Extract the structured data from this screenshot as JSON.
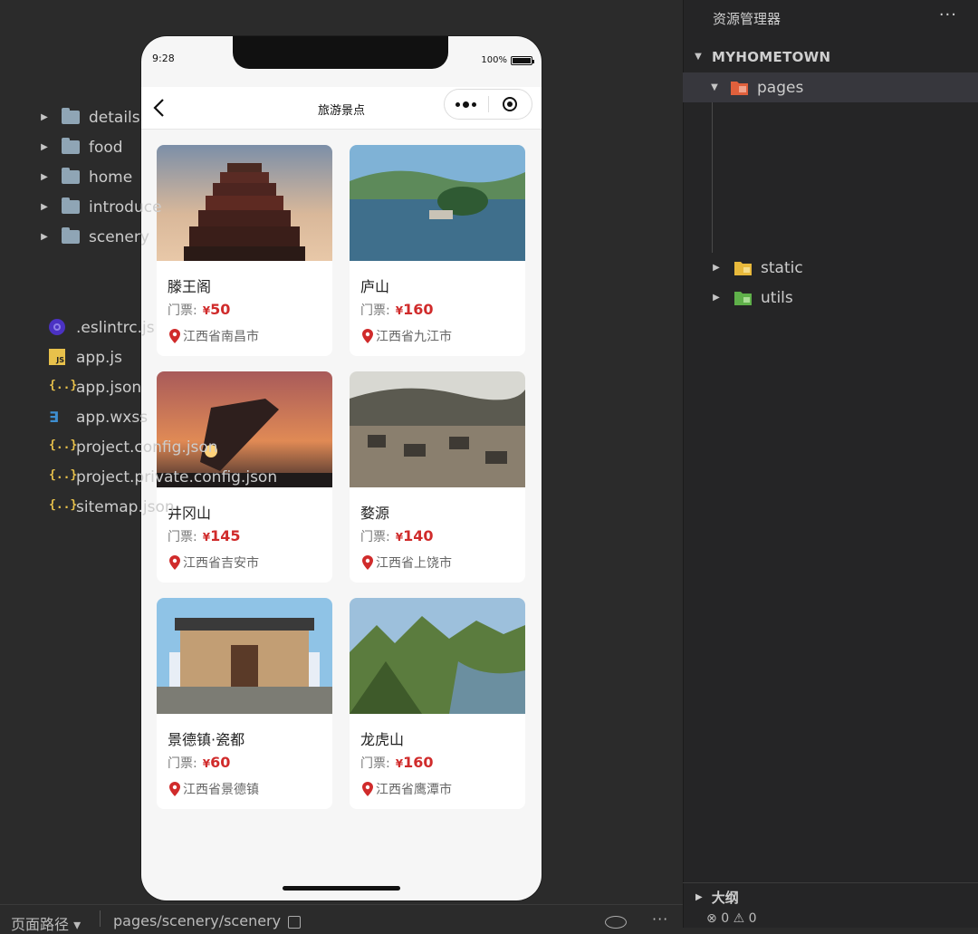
{
  "simulator": {
    "status": {
      "time": "9:28",
      "battery": "100%"
    },
    "navbar": {
      "title": "旅游景点"
    },
    "spots": [
      {
        "name": "滕王阁",
        "price_label": "门票:",
        "currency": "¥",
        "price": "50",
        "location": "江西省南昌市",
        "image": "pavilion"
      },
      {
        "name": "庐山",
        "price_label": "门票:",
        "currency": "¥",
        "price": "160",
        "location": "江西省九江市",
        "image": "lake"
      },
      {
        "name": "井冈山",
        "price_label": "门票:",
        "currency": "¥",
        "price": "145",
        "location": "江西省吉安市",
        "image": "monument"
      },
      {
        "name": "婺源",
        "price_label": "门票:",
        "currency": "¥",
        "price": "140",
        "location": "江西省上饶市",
        "image": "village"
      },
      {
        "name": "景德镇·瓷都",
        "price_label": "门票:",
        "currency": "¥",
        "price": "60",
        "location": "江西省景德镇",
        "image": "museum"
      },
      {
        "name": "龙虎山",
        "price_label": "门票:",
        "currency": "¥",
        "price": "160",
        "location": "江西省鹰潭市",
        "image": "mountains"
      }
    ]
  },
  "explorer": {
    "title": "资源管理器",
    "root": "MYHOMETOWN",
    "tree": {
      "pages": "pages",
      "pages_children": [
        "details",
        "food",
        "home",
        "introduce",
        "scenery"
      ],
      "static": "static",
      "utils": "utils",
      "files": [
        ".eslintrc.js",
        "app.js",
        "app.json",
        "app.wxss",
        "project.config.json",
        "project.private.config.json",
        "sitemap.json"
      ]
    },
    "outline": "大纲",
    "problems": {
      "errors": "0",
      "warnings": "0"
    }
  },
  "statusbar": {
    "label": "页面路径",
    "path": "pages/scenery/scenery"
  },
  "colors": {
    "price": "#d02b2b",
    "selected_row": "#37373d",
    "folder": "#8fa5b5"
  }
}
